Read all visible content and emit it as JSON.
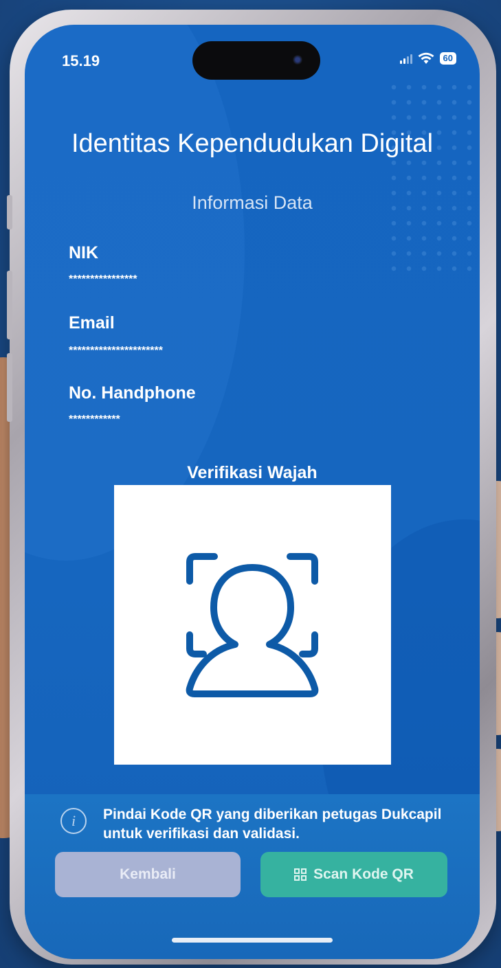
{
  "status_bar": {
    "time": "15.19",
    "battery": "60"
  },
  "header": {
    "title": "Identitas Kependudukan Digital",
    "subtitle": "Informasi Data"
  },
  "fields": [
    {
      "label": "NIK",
      "value": "****************"
    },
    {
      "label": "Email",
      "value": "**********************"
    },
    {
      "label": "No. Handphone",
      "value": "************"
    }
  ],
  "face_verification": {
    "title": "Verifikasi Wajah",
    "icon": "face-scan-icon"
  },
  "footer": {
    "info_text": "Pindai Kode QR yang diberikan petugas Dukcapil untuk verifikasi dan validasi.",
    "back_label": "Kembali",
    "scan_label": "Scan Kode QR"
  },
  "colors": {
    "primary": "#1565c0",
    "scan_button": "#36b2a0",
    "back_button": "#a9b3d4"
  }
}
